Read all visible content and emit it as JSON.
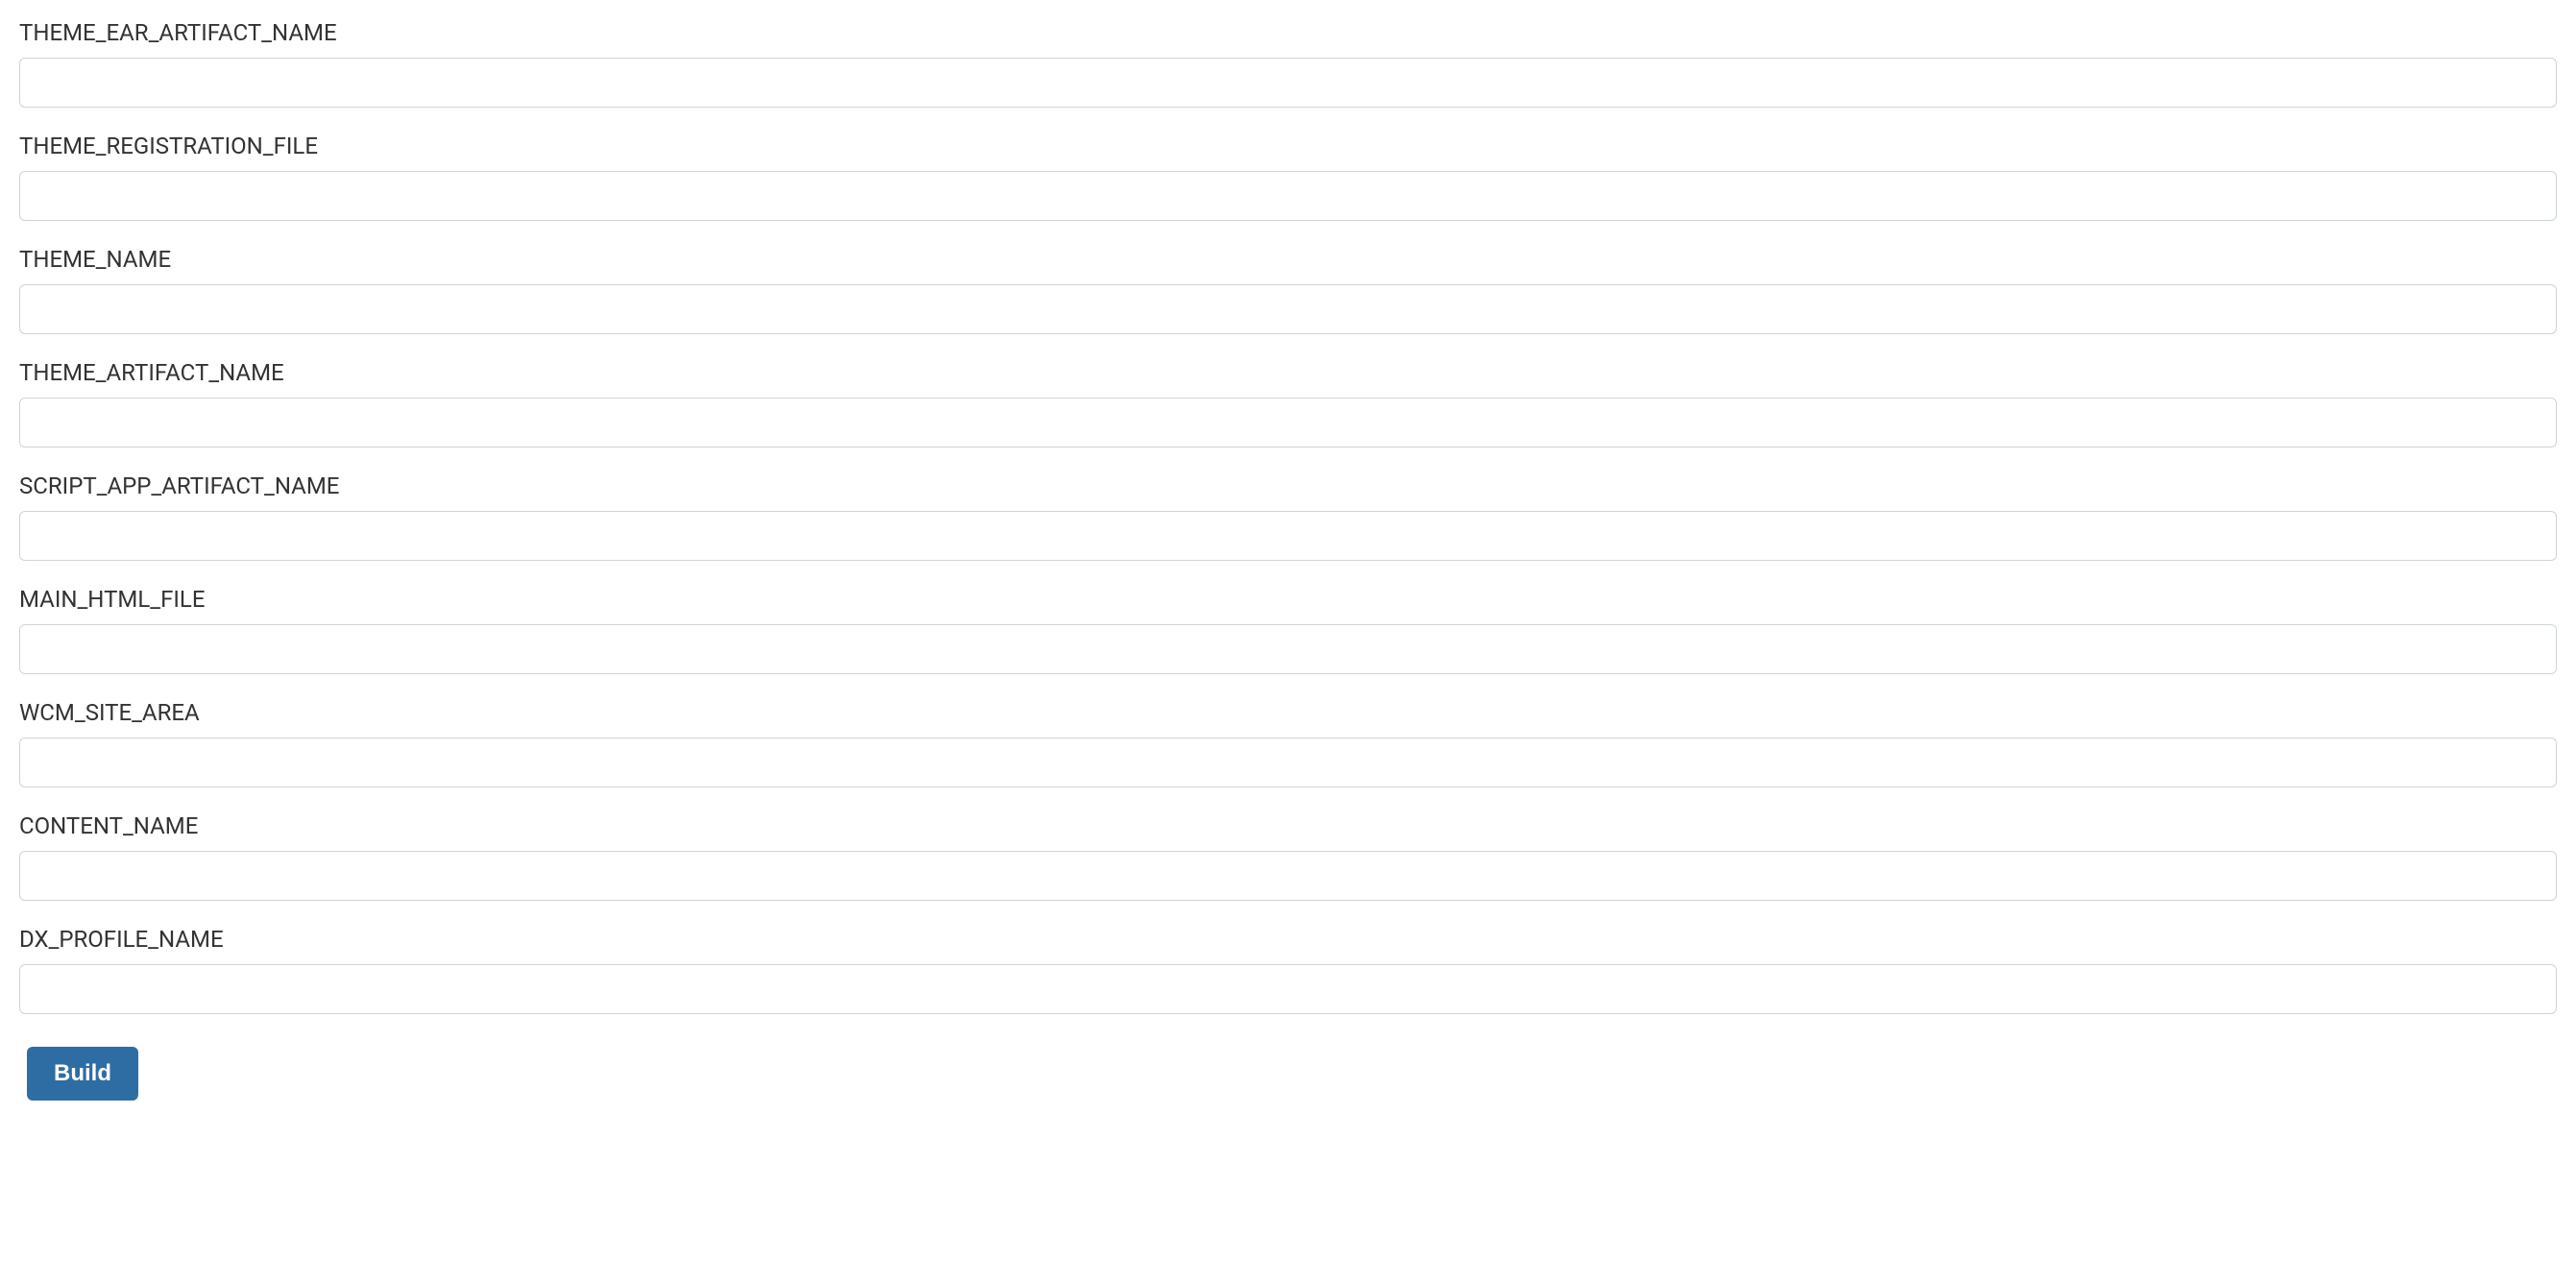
{
  "form": {
    "fields": [
      {
        "name": "theme-ear-artifact-name",
        "label": "THEME_EAR_ARTIFACT_NAME",
        "value": ""
      },
      {
        "name": "theme-registration-file",
        "label": "THEME_REGISTRATION_FILE",
        "value": ""
      },
      {
        "name": "theme-name",
        "label": "THEME_NAME",
        "value": ""
      },
      {
        "name": "theme-artifact-name",
        "label": "THEME_ARTIFACT_NAME",
        "value": ""
      },
      {
        "name": "script-app-artifact-name",
        "label": "SCRIPT_APP_ARTIFACT_NAME",
        "value": ""
      },
      {
        "name": "main-html-file",
        "label": "MAIN_HTML_FILE",
        "value": ""
      },
      {
        "name": "wcm-site-area",
        "label": "WCM_SITE_AREA",
        "value": ""
      },
      {
        "name": "content-name",
        "label": "CONTENT_NAME",
        "value": ""
      },
      {
        "name": "dx-profile-name",
        "label": "DX_PROFILE_NAME",
        "value": ""
      }
    ],
    "build_button_label": "Build"
  }
}
